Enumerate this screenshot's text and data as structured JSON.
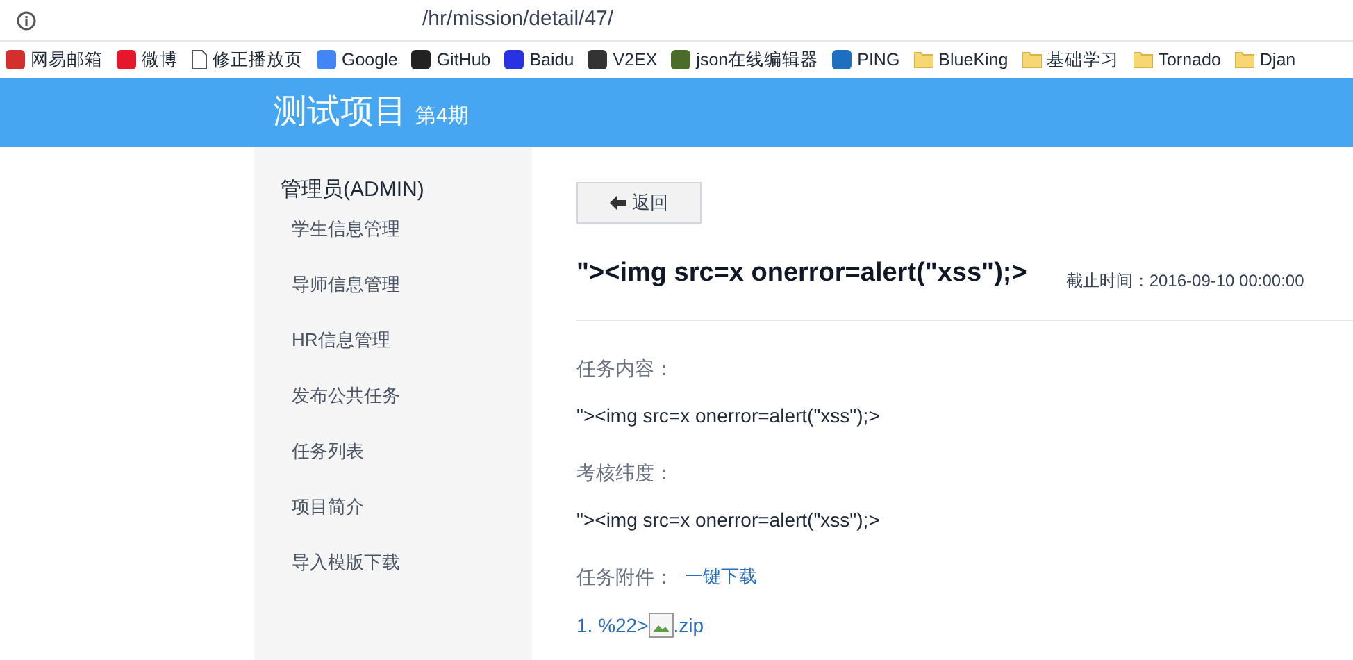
{
  "address_bar": {
    "url": "/hr/mission/detail/47/"
  },
  "bookmarks": [
    {
      "label": "网易邮箱",
      "kind": "site",
      "color": "#d32f2f"
    },
    {
      "label": "微博",
      "kind": "site",
      "color": "#e6162d"
    },
    {
      "label": "修正播放页",
      "kind": "page"
    },
    {
      "label": "Google",
      "kind": "site",
      "color": "#4285f4"
    },
    {
      "label": "GitHub",
      "kind": "site",
      "color": "#222222"
    },
    {
      "label": "Baidu",
      "kind": "site",
      "color": "#2932e1"
    },
    {
      "label": "V2EX",
      "kind": "site",
      "color": "#333333"
    },
    {
      "label": "json在线编辑器",
      "kind": "site",
      "color": "#4a6b2a"
    },
    {
      "label": "PING",
      "kind": "site",
      "color": "#1e6fbf"
    },
    {
      "label": "BlueKing",
      "kind": "folder"
    },
    {
      "label": "基础学习",
      "kind": "folder"
    },
    {
      "label": "Tornado",
      "kind": "folder"
    },
    {
      "label": "Djan",
      "kind": "folder"
    }
  ],
  "header": {
    "title": "测试项目",
    "issue": "第4期"
  },
  "sidebar": {
    "title": "管理员(ADMIN)",
    "items": [
      "学生信息管理",
      "导师信息管理",
      "HR信息管理",
      "发布公共任务",
      "任务列表",
      "项目简介",
      "导入模版下载"
    ]
  },
  "detail": {
    "back_button": "返回",
    "title": "\"><img src=x onerror=alert(\"xss\");>",
    "deadline": "截止时间：2016-09-10 00:00:00",
    "sections": [
      {
        "label": "任务内容：",
        "value": "\"><img src=x onerror=alert(\"xss\");>"
      },
      {
        "label": "考核纬度：",
        "value": "\"><img src=x onerror=alert(\"xss\");>"
      }
    ],
    "attachments_label": "任务附件：",
    "download_all": "一键下载",
    "attachments": [
      {
        "prefix": "1. %22>",
        "suffix": ".zip"
      }
    ]
  }
}
